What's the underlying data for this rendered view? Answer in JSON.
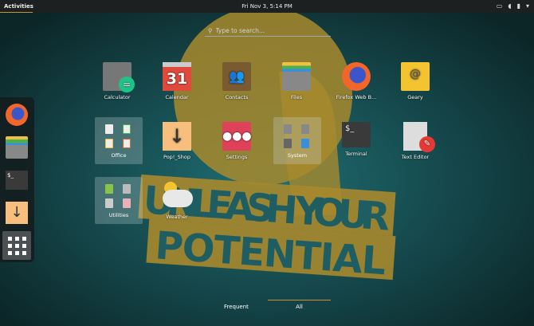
{
  "topbar": {
    "activities": "Activities",
    "clock": "Fri Nov 3, 5:14 PM",
    "tray": [
      "display-icon",
      "volume-icon",
      "battery-icon",
      "menu-arrow-icon"
    ]
  },
  "search": {
    "placeholder": "Type to search..."
  },
  "wallpaper": {
    "line1": "UNLEASH YOUR",
    "line2": "POTENTIAL"
  },
  "dash": [
    "firefox-icon",
    "files-icon",
    "terminal-icon",
    "pop-shop-icon",
    "show-apps-icon"
  ],
  "apps": {
    "calculator": "Calculator",
    "calendar": "Calendar",
    "calendar_day": "31",
    "contacts": "Contacts",
    "files": "Files",
    "firefox": "Firefox Web B...",
    "geary": "Geary",
    "office": "Office",
    "popshop": "Pop!_Shop",
    "settings": "Settings",
    "system": "System",
    "terminal": "Terminal",
    "terminal_prompt": "$_",
    "texteditor": "Text Editor",
    "utilities": "Utilities",
    "weather": "Weather"
  },
  "tabs": {
    "frequent": "Frequent",
    "all": "All",
    "active": "All"
  },
  "colors": {
    "accent": "#c8913a",
    "wallpaper_bg": "#12393d",
    "wallpaper_art": "#b8952e"
  }
}
